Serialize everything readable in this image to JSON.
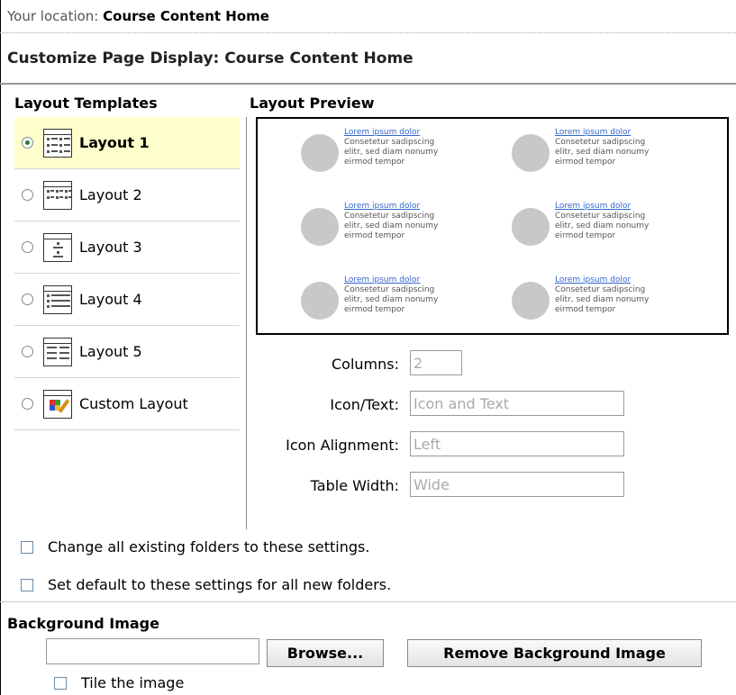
{
  "location": {
    "prefix": "Your location:",
    "value": "Course Content Home"
  },
  "page_title": "Customize Page Display: Course Content Home",
  "layout_templates": {
    "heading": "Layout Templates",
    "items": [
      {
        "label": "Layout 1",
        "selected": true
      },
      {
        "label": "Layout 2",
        "selected": false
      },
      {
        "label": "Layout 3",
        "selected": false
      },
      {
        "label": "Layout 4",
        "selected": false
      },
      {
        "label": "Layout 5",
        "selected": false
      },
      {
        "label": "Custom Layout",
        "selected": false
      }
    ]
  },
  "layout_preview": {
    "heading": "Layout Preview",
    "item": {
      "link": "Lorem ipsum dolor",
      "line1": "Consetetur sadipscing",
      "line2": "elitr, sed diam nonumy",
      "line3": "eirmod tempor"
    }
  },
  "fields": {
    "columns": {
      "label": "Columns:",
      "value": "2"
    },
    "icon_text": {
      "label": "Icon/Text:",
      "value": "Icon and Text"
    },
    "icon_alignment": {
      "label": "Icon Alignment:",
      "value": "Left"
    },
    "table_width": {
      "label": "Table Width:",
      "value": "Wide"
    }
  },
  "checkboxes": {
    "change_existing": "Change all existing folders to these settings.",
    "set_default": "Set default to these settings for all new folders."
  },
  "background_image": {
    "heading": "Background Image",
    "browse_label": "Browse...",
    "remove_label": "Remove Background Image",
    "tile_label": "Tile the image"
  }
}
